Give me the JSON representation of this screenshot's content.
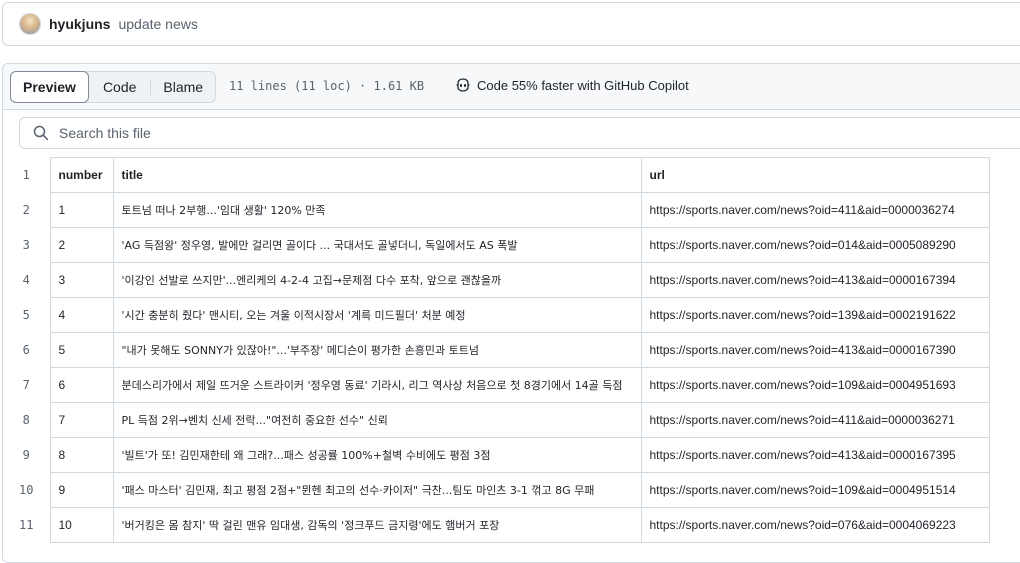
{
  "commit": {
    "user": "hyukjuns",
    "message": "update news"
  },
  "file_header": {
    "tabs": [
      {
        "label": "Preview",
        "active": true
      },
      {
        "label": "Code",
        "active": false
      },
      {
        "label": "Blame",
        "active": false
      }
    ],
    "meta": "11 lines (11 loc) · 1.61 KB",
    "copilot_label": "Code 55% faster with GitHub Copilot"
  },
  "search": {
    "placeholder": "Search this file"
  },
  "table": {
    "headers": [
      "number",
      "title",
      "url"
    ],
    "header_line_number": "1",
    "rows": [
      {
        "ln": "2",
        "number": "1",
        "title": "토트넘 떠나 2부행...'임대 생활' 120% 만족",
        "url": "https://sports.naver.com/news?oid=411&aid=0000036274"
      },
      {
        "ln": "3",
        "number": "2",
        "title": "'AG 득점왕' 정우영, 발에만 걸리면 골이다 ... 국대서도 골넣더니, 독일에서도 AS 폭발",
        "url": "https://sports.naver.com/news?oid=014&aid=0005089290"
      },
      {
        "ln": "4",
        "number": "3",
        "title": "'이강인 선발로 쓰지만'...엔리케의 4-2-4 고집→문제점 다수 포착, 앞으로 괜찮을까",
        "url": "https://sports.naver.com/news?oid=413&aid=0000167394"
      },
      {
        "ln": "5",
        "number": "4",
        "title": "'시간 충분히 줬다' 맨시티, 오는 겨울 이적시장서 '계륵 미드필더' 처분 예정",
        "url": "https://sports.naver.com/news?oid=139&aid=0002191622"
      },
      {
        "ln": "6",
        "number": "5",
        "title": "\"내가 못해도 SONNY가 있잖아!\"...'부주장' 메디슨이 평가한 손흥민과 토트넘",
        "url": "https://sports.naver.com/news?oid=413&aid=0000167390"
      },
      {
        "ln": "7",
        "number": "6",
        "title": "분데스리가에서 제일 뜨거운 스트라이커 '정우영 동료' 기라시, 리그 역사상 처음으로 첫 8경기에서 14골 득점",
        "url": "https://sports.naver.com/news?oid=109&aid=0004951693"
      },
      {
        "ln": "8",
        "number": "7",
        "title": "PL 득점 2위→벤치 신세 전락...\"여전히 중요한 선수\" 신뢰",
        "url": "https://sports.naver.com/news?oid=411&aid=0000036271"
      },
      {
        "ln": "9",
        "number": "8",
        "title": "'빌트'가 또! 김민재한테 왜 그래?...패스 성공률 100%+철벽 수비에도 평점 3점",
        "url": "https://sports.naver.com/news?oid=413&aid=0000167395"
      },
      {
        "ln": "10",
        "number": "9",
        "title": "'패스 마스터' 김민재, 최고 평점 2점+\"뮌헨 최고의 선수·카이저\" 극찬...팀도 마인츠 3-1 꺾고 8G 무패",
        "url": "https://sports.naver.com/news?oid=109&aid=0004951514"
      },
      {
        "ln": "11",
        "number": "10",
        "title": "'버거킹은 몸 참지' 딱 걸린 맨유 임대생, 감독의 '정크푸드 금지령'에도 햄버거 포장",
        "url": "https://sports.naver.com/news?oid=076&aid=0004069223"
      }
    ]
  }
}
